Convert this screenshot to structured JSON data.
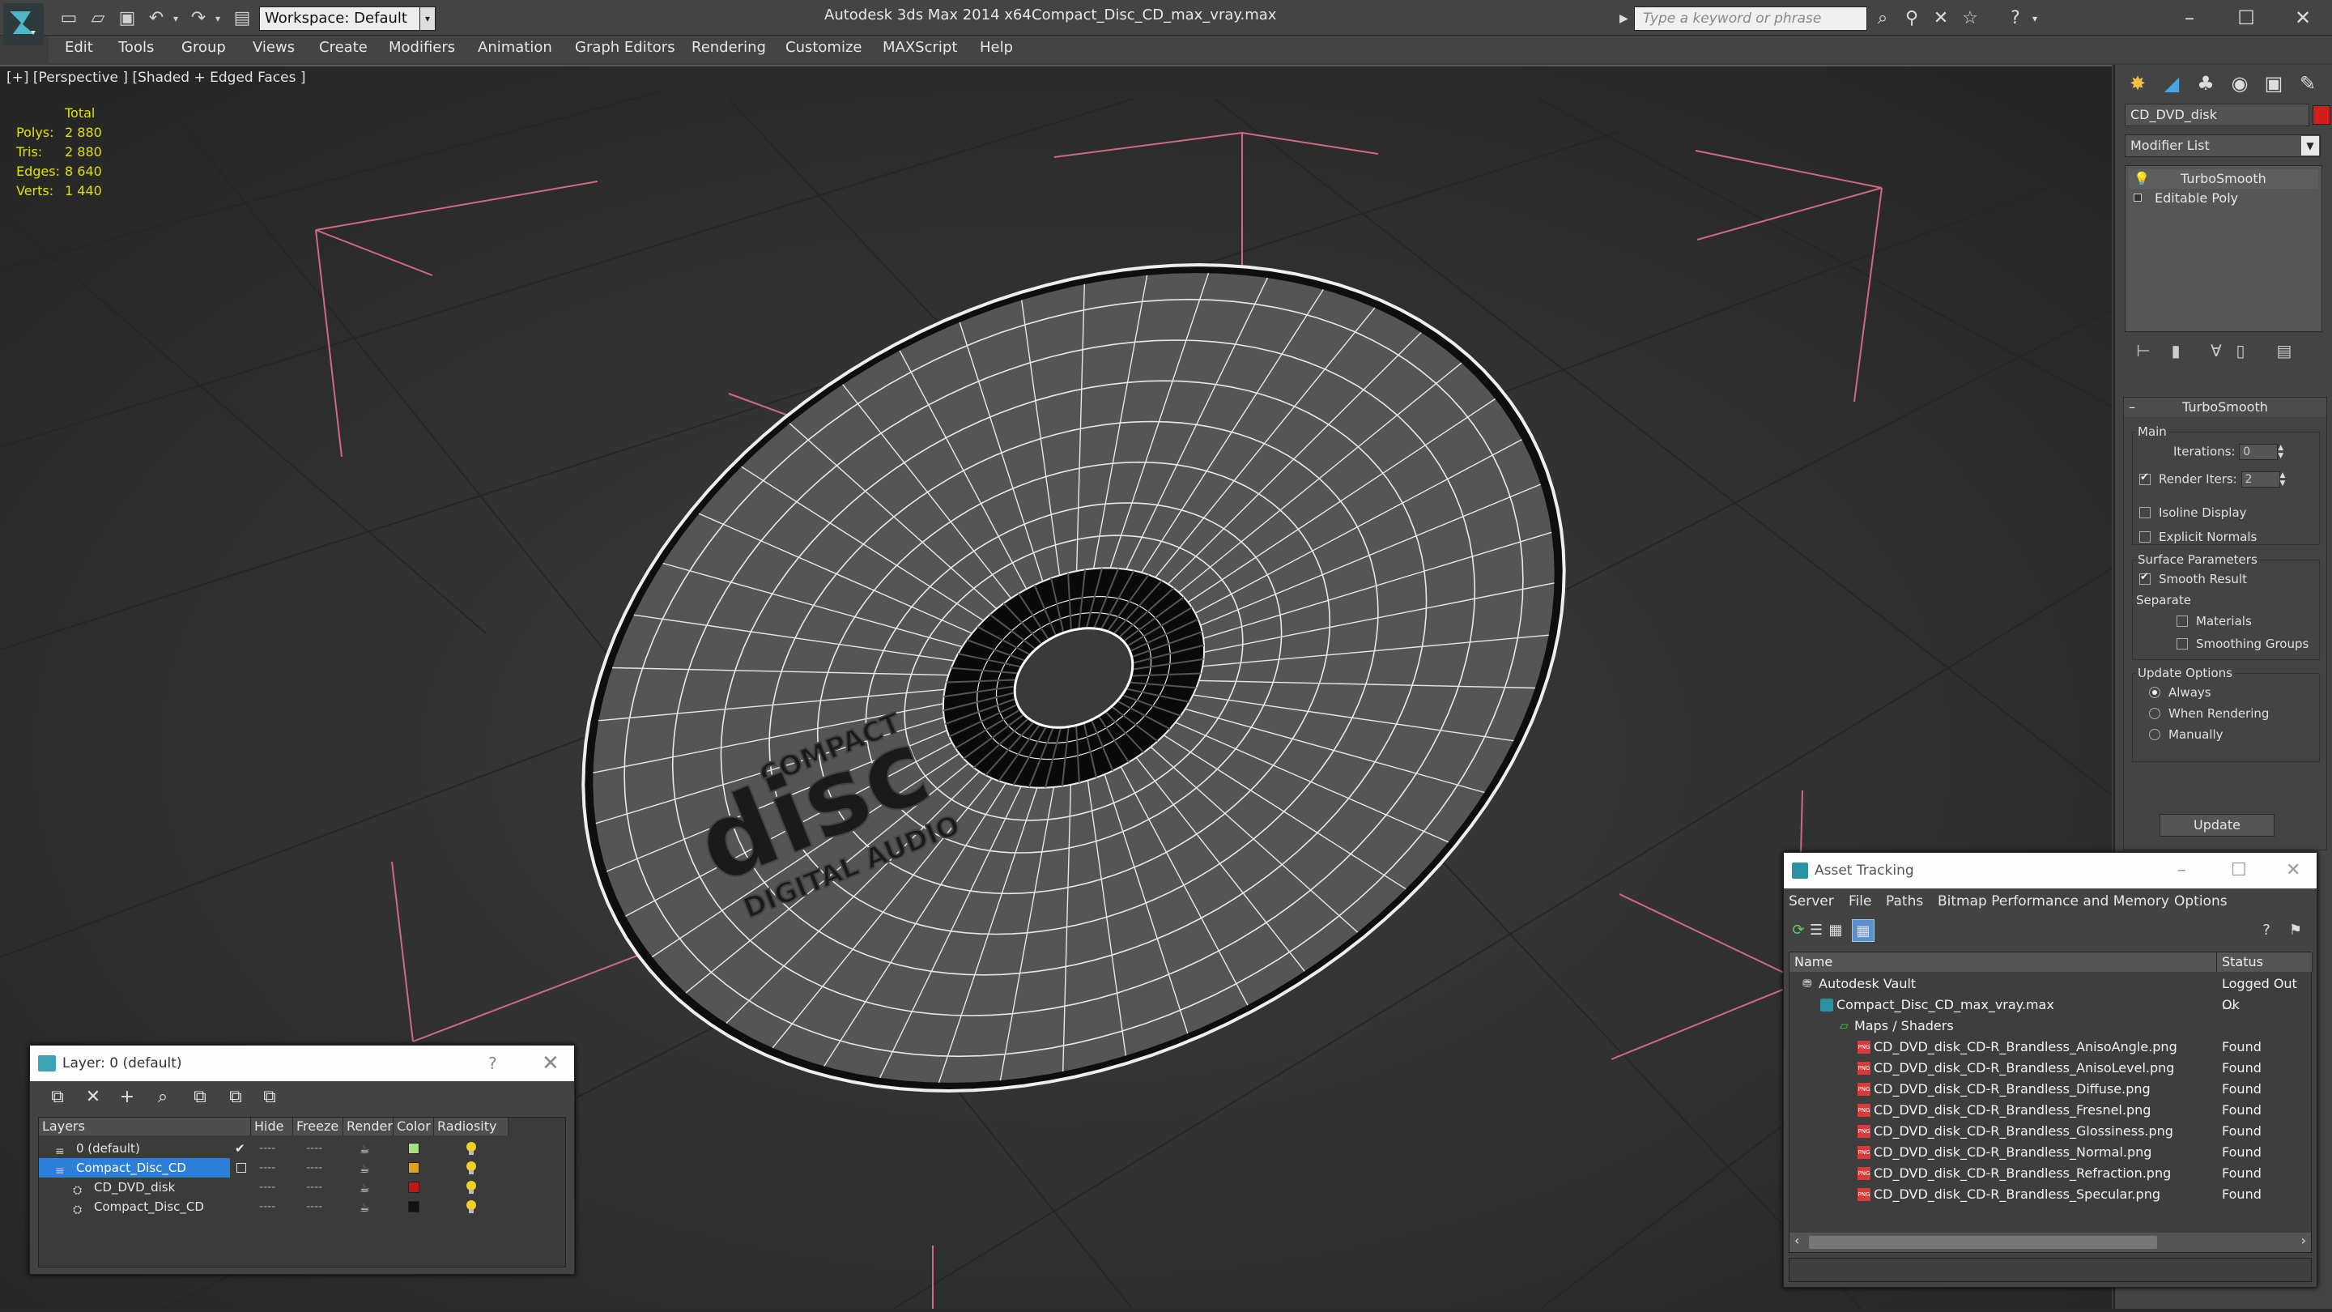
{
  "titlebar": {
    "app_title": "Autodesk 3ds Max  2014 x64",
    "file_title": "Compact_Disc_CD_max_vray.max",
    "workspace": "Workspace: Default",
    "search_placeholder": "Type a keyword or phrase"
  },
  "menubar": {
    "items": [
      "Edit",
      "Tools",
      "Group",
      "Views",
      "Create",
      "Modifiers",
      "Animation",
      "Graph Editors",
      "Rendering",
      "Customize",
      "MAXScript",
      "Help"
    ]
  },
  "viewport": {
    "label": "[+] [Perspective ] [Shaded + Edged Faces ]",
    "stats": {
      "header": "Total",
      "rows": [
        {
          "label": "Polys:",
          "value": "2 880"
        },
        {
          "label": "Tris:",
          "value": "2 880"
        },
        {
          "label": "Edges:",
          "value": "8 640"
        },
        {
          "label": "Verts:",
          "value": "1 440"
        }
      ]
    },
    "disc_label": {
      "line1": "COMPACT",
      "line2": "disc",
      "line3": "DIGITAL AUDIO"
    }
  },
  "command_panel": {
    "object_name": "CD_DVD_disk",
    "object_color": "#d31c1c",
    "modifier_list": "Modifier List",
    "stack": [
      "TurboSmooth",
      "Editable Poly"
    ],
    "turbosmooth": {
      "title": "TurboSmooth",
      "main_title": "Main",
      "iterations_label": "Iterations:",
      "iterations_value": "0",
      "render_iters_label": "Render Iters:",
      "render_iters_value": "2",
      "isoline_label": "Isoline Display",
      "explicit_label": "Explicit Normals",
      "surface_title": "Surface Parameters",
      "smooth_label": "Smooth Result",
      "separate_label": "Separate",
      "materials_label": "Materials",
      "smoothing_label": "Smoothing Groups",
      "update_title": "Update Options",
      "always_label": "Always",
      "when_rendering_label": "When Rendering",
      "manually_label": "Manually",
      "update_button": "Update"
    }
  },
  "layer_window": {
    "title": "Layer: 0 (default)",
    "help": "?",
    "columns": [
      "Layers",
      "Hide",
      "Freeze",
      "Render",
      "Color",
      "Radiosity"
    ],
    "rows": [
      {
        "name": "0 (default)",
        "color": "#a6e080"
      },
      {
        "name": "Compact_Disc_CD",
        "color": "#e0a020"
      },
      {
        "name": "CD_DVD_disk",
        "color": "#c01818"
      },
      {
        "name": "Compact_Disc_CD",
        "color": "#111111"
      }
    ],
    "dash": "----"
  },
  "asset_tracking": {
    "title": "Asset Tracking",
    "menu": [
      "Server",
      "File",
      "Paths",
      "Bitmap Performance and Memory",
      "Options"
    ],
    "columns": [
      "Name",
      "Status"
    ],
    "rows": [
      {
        "name": "Autodesk Vault",
        "status": "Logged Out ..."
      },
      {
        "name": "Compact_Disc_CD_max_vray.max",
        "status": "Ok"
      },
      {
        "name": "Maps / Shaders",
        "status": ""
      },
      {
        "name": "CD_DVD_disk_CD-R_Brandless_AnisoAngle.png",
        "status": "Found"
      },
      {
        "name": "CD_DVD_disk_CD-R_Brandless_AnisoLevel.png",
        "status": "Found"
      },
      {
        "name": "CD_DVD_disk_CD-R_Brandless_Diffuse.png",
        "status": "Found"
      },
      {
        "name": "CD_DVD_disk_CD-R_Brandless_Fresnel.png",
        "status": "Found"
      },
      {
        "name": "CD_DVD_disk_CD-R_Brandless_Glossiness.png",
        "status": "Found"
      },
      {
        "name": "CD_DVD_disk_CD-R_Brandless_Normal.png",
        "status": "Found"
      },
      {
        "name": "CD_DVD_disk_CD-R_Brandless_Refraction.png",
        "status": "Found"
      },
      {
        "name": "CD_DVD_disk_CD-R_Brandless_Specular.png",
        "status": "Found"
      }
    ]
  }
}
